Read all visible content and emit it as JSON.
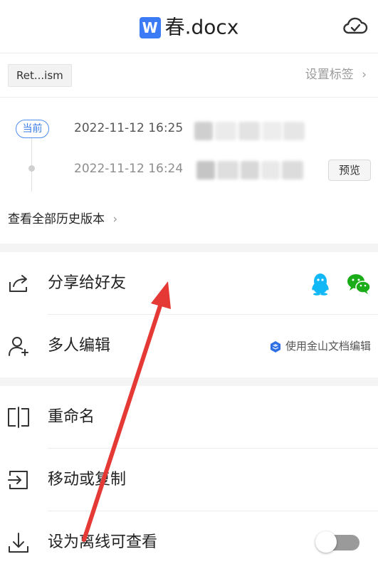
{
  "header": {
    "title": "春.docx",
    "file_icon_letter": "W"
  },
  "tag_row": {
    "tag_label": "Ret...ism",
    "set_tag_label": "设置标签"
  },
  "history": {
    "current_label": "当前",
    "versions": [
      {
        "time": "2022-11-12 16:25"
      },
      {
        "time": "2022-11-12 16:24",
        "action": "预览"
      }
    ],
    "view_all_label": "查看全部历史版本"
  },
  "menu": {
    "share_label": "分享给好友",
    "collab_label": "多人编辑",
    "collab_hint": "使用金山文档编辑",
    "rename_label": "重命名",
    "move_label": "移动或复制",
    "offline_label": "设为离线可查看",
    "offline_enabled": false
  },
  "colors": {
    "accent": "#3b7bf6",
    "annotation_arrow": "#e53935",
    "wechat": "#1aad19",
    "qq": "#12b7f5"
  },
  "icons": [
    "word-file-icon",
    "cloud-sync-icon",
    "share-icon",
    "qq-icon",
    "wechat-icon",
    "add-user-icon",
    "kingsoft-docs-icon",
    "rename-icon",
    "move-icon",
    "download-icon"
  ]
}
